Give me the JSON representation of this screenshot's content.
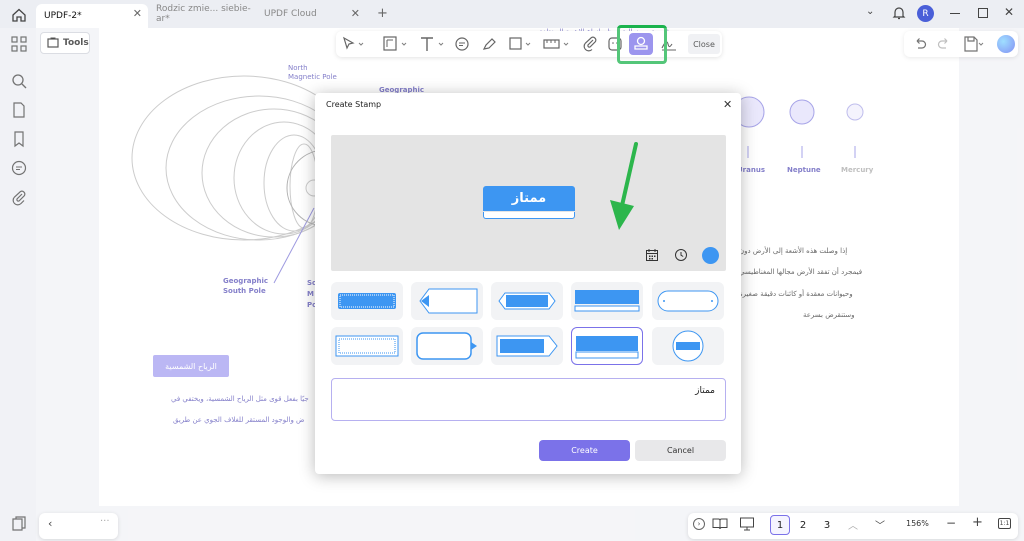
{
  "tabs": [
    {
      "label": "UPDF-2*",
      "active": true
    },
    {
      "label": "Rodzic zmie... siebie-ar*",
      "active": false
    },
    {
      "label": "UPDF Cloud",
      "active": false
    }
  ],
  "user_avatar": "R",
  "tools_label": "Tools",
  "close_label": "Close",
  "dialog": {
    "title": "Create Stamp",
    "stamp_text": "ممتاز",
    "textarea_value": "ممتاز",
    "create_label": "Create",
    "cancel_label": "Cancel"
  },
  "page_bg": {
    "north_pole": "North\nMagnetic Pole",
    "geographic": "Geographic",
    "geo_south": "Geographic\nSouth Pole",
    "so_labels": [
      "So",
      "M",
      "Po"
    ],
    "planets": [
      "Uranus",
      "Neptune",
      "Mercury"
    ],
    "arabic_top": "فهو يقوم بفعالية معظم انواع الاشعة المختلفة",
    "arabic_lines": [
      "إذا وصلت هذه الأشعة إلى الأرض دون",
      "فيمجرد أن تفقد الأرض مجالها المغناطيسي",
      "وحيوانات معقدة أو كائنات دقيقة صغيرة",
      "وستنقرض بسرعة"
    ],
    "badge": "الرياح الشمسية",
    "left_lines": [
      "جيًا بفعل قوى مثل الرياح الشمسية، ويختفي في",
      "ض والوجود المستقر للغلاف الجوي عن طريق"
    ]
  },
  "bottom": {
    "pages": [
      "1",
      "2",
      "3"
    ],
    "current_page": "1",
    "zoom": "156%"
  },
  "colors": {
    "accent": "#7b72e9",
    "stamp_blue": "#3d96f2",
    "highlight": "#1bb34d",
    "arrow": "#2cb64c"
  }
}
